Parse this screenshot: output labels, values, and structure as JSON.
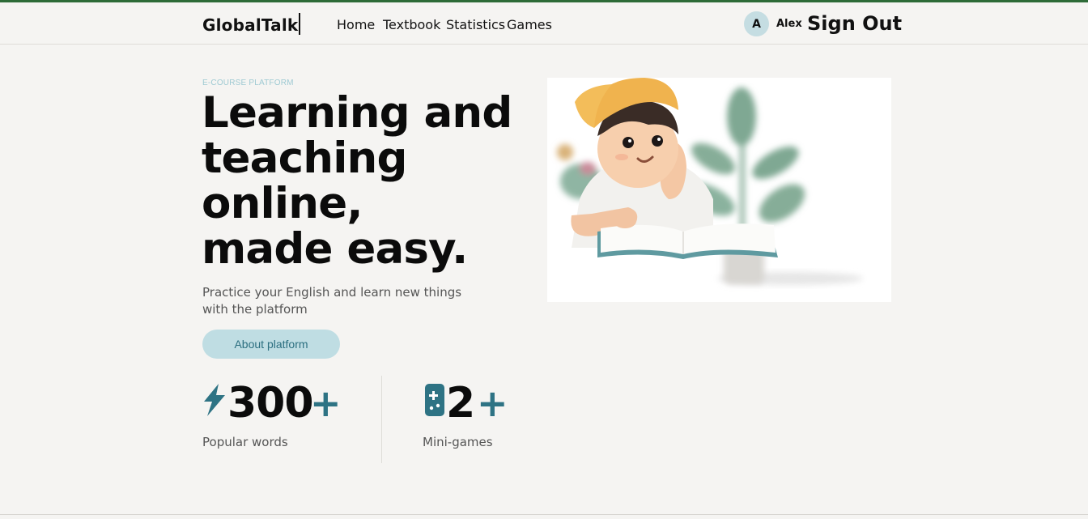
{
  "header": {
    "logo": "GlobalTalk",
    "nav": [
      "Home",
      "Textbook",
      "Statistics",
      "Games"
    ],
    "user": {
      "avatar_initial": "A",
      "name": "Alex"
    },
    "sign_out_label": "Sign Out"
  },
  "hero": {
    "eyebrow": "E-COURSE PLATFORM",
    "headline_lines": [
      "Learning and",
      "teaching",
      "online,",
      "made easy."
    ],
    "subtext": "Practice your English and learn new things with the platform",
    "about_button_label": "About platform",
    "image_icon": "boy-reading-book-illustration"
  },
  "stats": [
    {
      "icon": "lightning-bolt-icon",
      "number": "300",
      "suffix": "+",
      "label": "Popular words"
    },
    {
      "icon": "gamepad-icon",
      "number": "2",
      "suffix": "+",
      "label": "Mini-games"
    }
  ],
  "colors": {
    "top_strip": "#2e6b38",
    "accent_teal": "#2e7384",
    "button_bg": "#bfdde3",
    "avatar_bg": "#c5dde2",
    "page_bg": "#f5f4f2"
  }
}
